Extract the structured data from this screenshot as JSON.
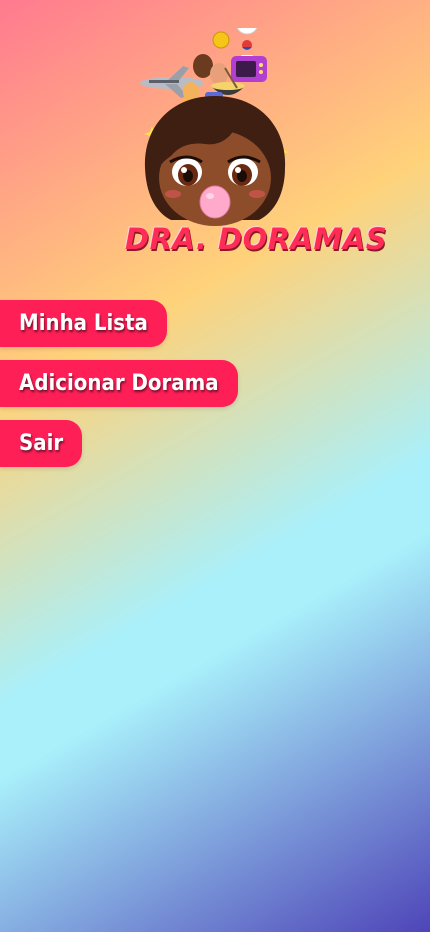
{
  "logo": {
    "text": "DRA. DORAMAS",
    "alt": "Dra. Doramas mascot"
  },
  "menu": {
    "items": [
      {
        "label": "Minha Lista"
      },
      {
        "label": "Adicionar Dorama"
      },
      {
        "label": "Sair"
      }
    ]
  },
  "colors": {
    "button": "#ff1f57",
    "button_text": "#ffffff",
    "gradient_start": "#ff7a8f",
    "gradient_mid": "#a9f0fb",
    "gradient_end": "#4e45b8"
  }
}
